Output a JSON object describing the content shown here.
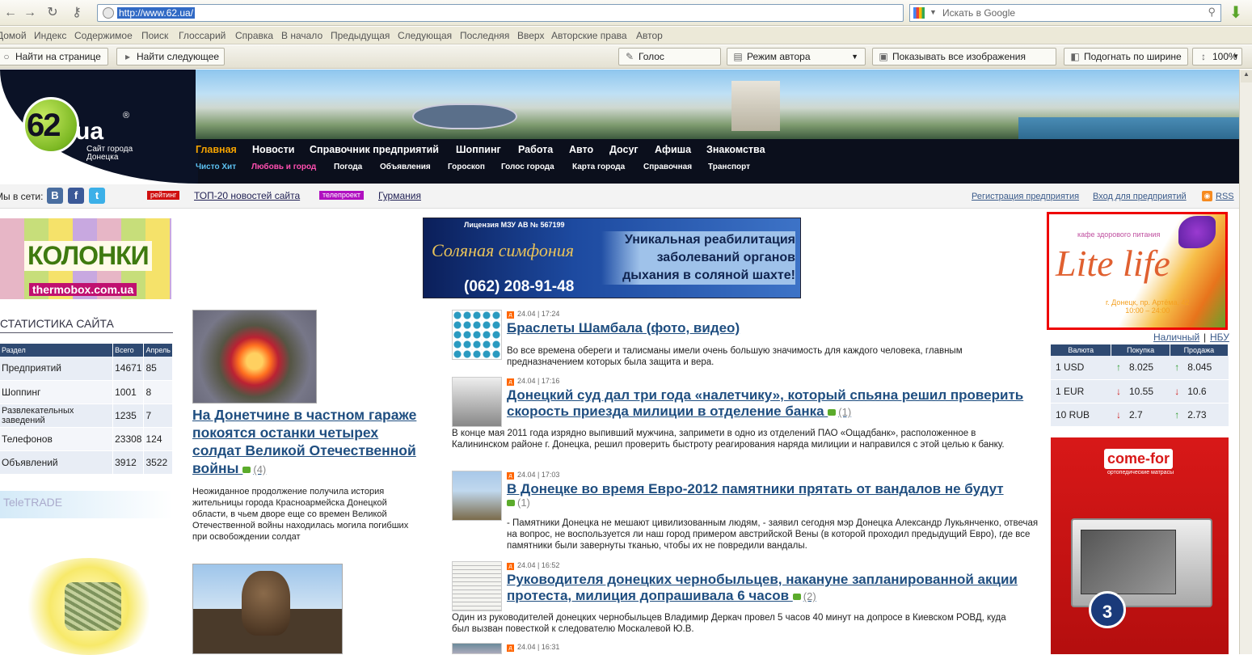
{
  "browser": {
    "url": "http://www.62.ua/",
    "search_placeholder": "Искать в Google",
    "nav_links": [
      "Домой",
      "Индекс",
      "Содержимое",
      "Поиск",
      "Глоссарий",
      "Справка",
      "В начало",
      "Предыдущая",
      "Следующая",
      "Последняя",
      "Вверх",
      "Авторские права",
      "Автор"
    ],
    "find_placeholder": "Найти на странице",
    "find_next": "Найти следующее",
    "voice": "Голос",
    "author_mode": "Режим автора",
    "show_images": "Показывать все изображения",
    "fit_width": "Подогнать по ширине",
    "zoom": "100%"
  },
  "header": {
    "logo_num": "62",
    "logo_ua": "ua",
    "logo_reg": "®",
    "logo_sub": "Сайт города Донецка",
    "menu_main": [
      "Главная",
      "Новости",
      "Справочник предприятий",
      "Шоппинг",
      "Работа",
      "Авто",
      "Досуг",
      "Афиша",
      "Знакомства"
    ],
    "menu_sub": [
      "Чисто Хит",
      "Любовь и город",
      "Погода",
      "Объявления",
      "Гороскоп",
      "Голос города",
      "Карта города",
      "Справочная",
      "Транспорт"
    ]
  },
  "subbar": {
    "social_label": "Мы в сети:",
    "social_icons": [
      "vkontakte-icon",
      "facebook-icon",
      "twitter-icon"
    ],
    "rating_tag": "рейтинг",
    "rating_link": "ТОП-20 новостей сайта",
    "tv_tag": "телепроект",
    "tv_link": "Гурмания",
    "reg_link": "Регистрация предприятия",
    "login_link": "Вход для предприятий",
    "rss": "RSS"
  },
  "left_ad": {
    "title": "КОЛОНКИ",
    "url": "thermobox.com.ua"
  },
  "stats": {
    "heading": "СТАТИСТИКА САЙТА",
    "columns": [
      "Раздел",
      "Всего",
      "Апрель"
    ],
    "rows": [
      [
        "Предприятий",
        "14671",
        "85"
      ],
      [
        "Шоппинг",
        "1001",
        "8"
      ],
      [
        "Развлекательных заведений",
        "1235",
        "7"
      ],
      [
        "Телефонов",
        "23308",
        "124"
      ],
      [
        "Объявлений",
        "3912",
        "3522"
      ]
    ]
  },
  "teletrade": "TeleTRADE",
  "feature": {
    "title": "На Донетчине в частном гараже покоятся останки четырех солдат Великой Отечественной войны",
    "comments": "(4)",
    "text": "Неожиданное продолжение получила история жительницы города Красноармейска Донецкой области, в чьем дворе еще со времен Великой Отечественной войны находилась могила погибших при освобождении солдат"
  },
  "banner": {
    "license": "Лицензия МЗУ АВ № 567199",
    "logo": "Соляная симфония",
    "phone": "(062) 208-91-48",
    "text": "Уникальная реабилитация заболеваний органов дыхания в соляной шахте!"
  },
  "news": [
    {
      "date": "24.04",
      "time": "17:24",
      "title": "Браслеты Шамбала (фото, видео)",
      "comments": "",
      "text": "Во все времена обереги и талисманы имели очень большую значимость для каждого человека, главным предназначением которых была защита и вера."
    },
    {
      "date": "24.04",
      "time": "17:16",
      "title": "Донецкий суд дал три года «налетчику», который спьяна решил проверить скорость приезда милиции в отделение банка",
      "comments": "(1)",
      "text": "В конце мая 2011 года изрядно выпивший мужчина, запримети в одно из отделений ПАО «Ощадбанк», расположенное в Калининском районе г. Донецка, решил проверить быстроту реагирования наряда милиции и направился с этой целью к банку."
    },
    {
      "date": "24.04",
      "time": "17:03",
      "title": "В Донецке во время Евро-2012 памятники прятать от вандалов не будут",
      "comments": "(1)",
      "text": "- Памятники Донецка не мешают цивилизованным людям, - заявил сегодня мэр Донецка Александр Лукьянченко, отвечая на вопрос, не воспользуется ли наш город примером австрийской Вены (в которой проходил предыдущий Евро), где все памятники были завернуты тканью, чтобы их не повредили вандалы."
    },
    {
      "date": "24.04",
      "time": "16:52",
      "title": "Руководителя донецких чернобыльцев, накануне запланированной акции протеста, милиция допрашивала 6 часов",
      "comments": "(2)",
      "text": "Один из руководителей донецких чернобыльцев Владимир Деркач провел 5 часов 40 минут на допросе в Киевском РОВД, куда был вызван повесткой к следователю Москалевой Ю.В."
    },
    {
      "date": "24.04",
      "time": "16:31",
      "title": "",
      "comments": "",
      "text": ""
    }
  ],
  "right_ad": {
    "cafe": "кафе здорового питания",
    "name": "Lite life",
    "addr": "г. Донецк, пр. Артёма, 42",
    "hours": "10:00 – 24:00"
  },
  "rates": {
    "links": [
      "Наличный",
      "НБУ"
    ],
    "columns": [
      "Валюта",
      "Покупка",
      "Продажа"
    ],
    "rows": [
      {
        "cur": "1 USD",
        "buy_dir": "↑",
        "buy": "8.025",
        "sell_dir": "↑",
        "sell": "8.045"
      },
      {
        "cur": "1 EUR",
        "buy_dir": "↓",
        "buy": "10.55",
        "sell_dir": "↓",
        "sell": "10.6"
      },
      {
        "cur": "10 RUB",
        "buy_dir": "↓",
        "buy": "2.7",
        "sell_dir": "↑",
        "sell": "2.73"
      }
    ]
  },
  "comefor": {
    "brand": "come-for",
    "sub": "ортопедические матрасы",
    "badge": "3"
  }
}
